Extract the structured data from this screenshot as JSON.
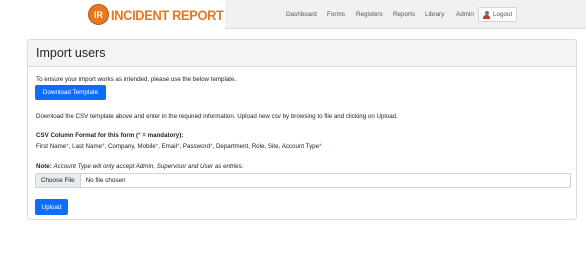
{
  "brand": {
    "badge": "IR",
    "name": "INCIDENT REPORT"
  },
  "nav": {
    "items": [
      "Dashboard",
      "Forms",
      "Registers",
      "Reports",
      "Library",
      "Admin"
    ],
    "logout_label": "Logout"
  },
  "page": {
    "title": "Import users",
    "intro": "To ensure your import works as intended, please use the below template.",
    "download_button": "Download Template",
    "instructions": "Download the CSV template above and enter in the required information. Upload new csv by browsing to file and clicking on Upload.",
    "format_heading_prefix": "CSV Column Format for this form (",
    "format_heading_star": "*",
    "format_heading_suffix": " = mandatory):",
    "columns": [
      {
        "name": "First Name",
        "mandatory": true
      },
      {
        "name": "Last Name",
        "mandatory": true
      },
      {
        "name": "Company",
        "mandatory": false
      },
      {
        "name": "Mobile",
        "mandatory": true
      },
      {
        "name": "Email",
        "mandatory": true
      },
      {
        "name": "Password",
        "mandatory": true
      },
      {
        "name": "Department",
        "mandatory": false
      },
      {
        "name": "Role",
        "mandatory": false
      },
      {
        "name": "Site",
        "mandatory": false
      },
      {
        "name": "Account Type",
        "mandatory": true
      }
    ],
    "note_label": "Note:",
    "note_text": "Account Type will only accept Admin, Supervisor and User as entries.",
    "file_button": "Choose File",
    "file_status": "No file chosen",
    "upload_button": "Upload"
  },
  "colors": {
    "brand_orange": "#e8771f",
    "primary": "#0d6efd",
    "mandatory_red": "#dc3545"
  }
}
